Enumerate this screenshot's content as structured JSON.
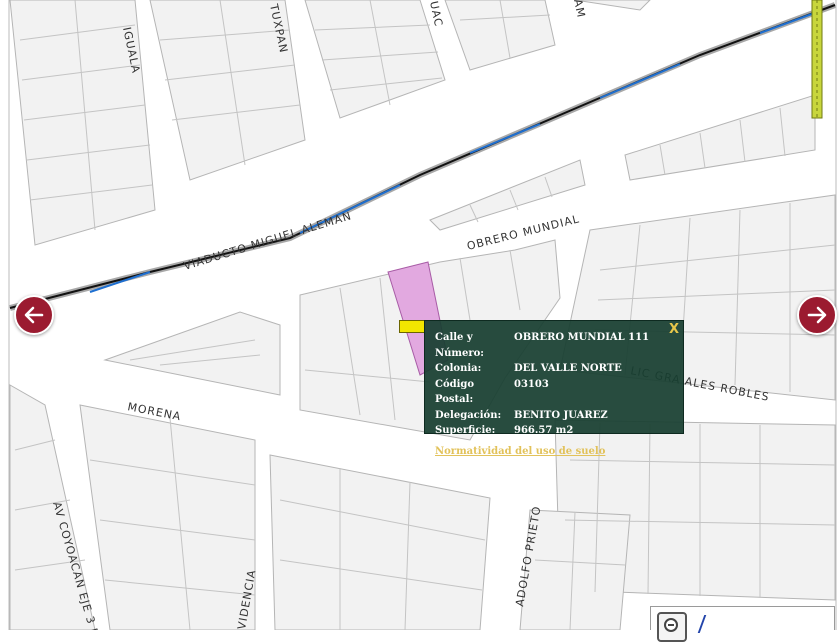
{
  "map": {
    "colors": {
      "block_fill": "#f2f2f2",
      "block_stroke": "#b5b5b5",
      "road": "#ffffff",
      "viaduct_line": "#111111",
      "viaduct_accent": "#1e6fd0",
      "selected_parcel": "#e2a9e0",
      "marker": "#f2e600",
      "nav_button": "#9b1b30",
      "popup_background": "#183e30",
      "popup_link": "#e2c25a"
    },
    "street_labels": {
      "iguala": "IGUALA",
      "tuxpan": "TUXPAN",
      "uac": "UAC",
      "am": "AM",
      "viaducto": "VIADUCTO MIGUEL ALEMAN",
      "obrero_mundial": "OBRERO MUNDIAL",
      "lic_gonzales_robles": "LIC GRA  ALES ROBLES",
      "morena": "MORENA",
      "av_coyoacan": "AV COYOACAN EJE 3 P",
      "adolfo_prieto": "ADOLFO PRIETO",
      "providencia": "VIDENCIA"
    },
    "nav": {
      "left_icon": "arrow-left-icon",
      "right_icon": "arrow-right-icon"
    }
  },
  "popup": {
    "close_label": "X",
    "rows": [
      {
        "label": "Calle y Número:",
        "value": "OBRERO MUNDIAL 111"
      },
      {
        "label": "Colonia:",
        "value": "DEL VALLE NORTE"
      },
      {
        "label": "Código Postal:",
        "value": "03103"
      },
      {
        "label": "Delegación:",
        "value": "BENITO JUAREZ"
      },
      {
        "label": "Superficie:",
        "value": "966.57 m2"
      }
    ],
    "link_label": "Normatividad del uso de suelo"
  },
  "scale": {
    "zoom_out_icon": "magnifier-minus-icon"
  }
}
